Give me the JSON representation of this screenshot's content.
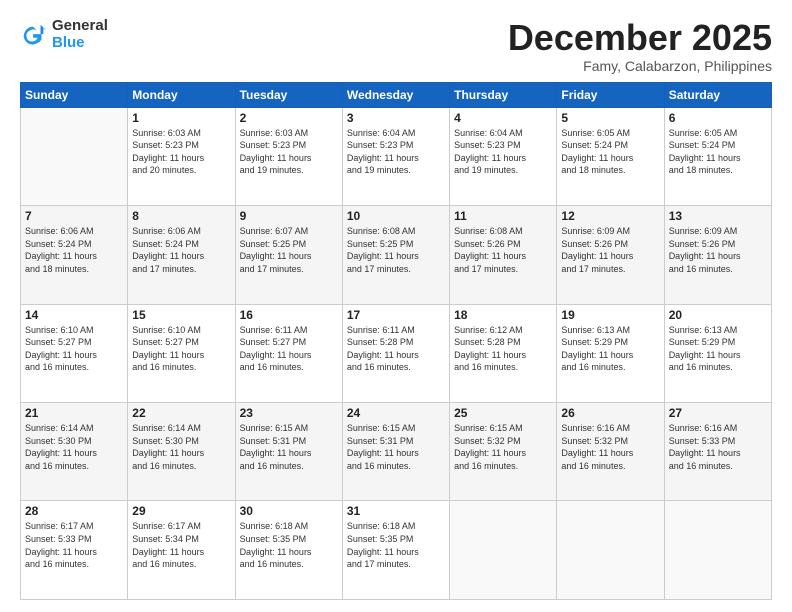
{
  "logo": {
    "general": "General",
    "blue": "Blue"
  },
  "header": {
    "month": "December 2025",
    "location": "Famy, Calabarzon, Philippines"
  },
  "days_of_week": [
    "Sunday",
    "Monday",
    "Tuesday",
    "Wednesday",
    "Thursday",
    "Friday",
    "Saturday"
  ],
  "weeks": [
    [
      {
        "day": "",
        "info": ""
      },
      {
        "day": "1",
        "info": "Sunrise: 6:03 AM\nSunset: 5:23 PM\nDaylight: 11 hours\nand 20 minutes."
      },
      {
        "day": "2",
        "info": "Sunrise: 6:03 AM\nSunset: 5:23 PM\nDaylight: 11 hours\nand 19 minutes."
      },
      {
        "day": "3",
        "info": "Sunrise: 6:04 AM\nSunset: 5:23 PM\nDaylight: 11 hours\nand 19 minutes."
      },
      {
        "day": "4",
        "info": "Sunrise: 6:04 AM\nSunset: 5:23 PM\nDaylight: 11 hours\nand 19 minutes."
      },
      {
        "day": "5",
        "info": "Sunrise: 6:05 AM\nSunset: 5:24 PM\nDaylight: 11 hours\nand 18 minutes."
      },
      {
        "day": "6",
        "info": "Sunrise: 6:05 AM\nSunset: 5:24 PM\nDaylight: 11 hours\nand 18 minutes."
      }
    ],
    [
      {
        "day": "7",
        "info": "Sunrise: 6:06 AM\nSunset: 5:24 PM\nDaylight: 11 hours\nand 18 minutes."
      },
      {
        "day": "8",
        "info": "Sunrise: 6:06 AM\nSunset: 5:24 PM\nDaylight: 11 hours\nand 17 minutes."
      },
      {
        "day": "9",
        "info": "Sunrise: 6:07 AM\nSunset: 5:25 PM\nDaylight: 11 hours\nand 17 minutes."
      },
      {
        "day": "10",
        "info": "Sunrise: 6:08 AM\nSunset: 5:25 PM\nDaylight: 11 hours\nand 17 minutes."
      },
      {
        "day": "11",
        "info": "Sunrise: 6:08 AM\nSunset: 5:26 PM\nDaylight: 11 hours\nand 17 minutes."
      },
      {
        "day": "12",
        "info": "Sunrise: 6:09 AM\nSunset: 5:26 PM\nDaylight: 11 hours\nand 17 minutes."
      },
      {
        "day": "13",
        "info": "Sunrise: 6:09 AM\nSunset: 5:26 PM\nDaylight: 11 hours\nand 16 minutes."
      }
    ],
    [
      {
        "day": "14",
        "info": "Sunrise: 6:10 AM\nSunset: 5:27 PM\nDaylight: 11 hours\nand 16 minutes."
      },
      {
        "day": "15",
        "info": "Sunrise: 6:10 AM\nSunset: 5:27 PM\nDaylight: 11 hours\nand 16 minutes."
      },
      {
        "day": "16",
        "info": "Sunrise: 6:11 AM\nSunset: 5:27 PM\nDaylight: 11 hours\nand 16 minutes."
      },
      {
        "day": "17",
        "info": "Sunrise: 6:11 AM\nSunset: 5:28 PM\nDaylight: 11 hours\nand 16 minutes."
      },
      {
        "day": "18",
        "info": "Sunrise: 6:12 AM\nSunset: 5:28 PM\nDaylight: 11 hours\nand 16 minutes."
      },
      {
        "day": "19",
        "info": "Sunrise: 6:13 AM\nSunset: 5:29 PM\nDaylight: 11 hours\nand 16 minutes."
      },
      {
        "day": "20",
        "info": "Sunrise: 6:13 AM\nSunset: 5:29 PM\nDaylight: 11 hours\nand 16 minutes."
      }
    ],
    [
      {
        "day": "21",
        "info": "Sunrise: 6:14 AM\nSunset: 5:30 PM\nDaylight: 11 hours\nand 16 minutes."
      },
      {
        "day": "22",
        "info": "Sunrise: 6:14 AM\nSunset: 5:30 PM\nDaylight: 11 hours\nand 16 minutes."
      },
      {
        "day": "23",
        "info": "Sunrise: 6:15 AM\nSunset: 5:31 PM\nDaylight: 11 hours\nand 16 minutes."
      },
      {
        "day": "24",
        "info": "Sunrise: 6:15 AM\nSunset: 5:31 PM\nDaylight: 11 hours\nand 16 minutes."
      },
      {
        "day": "25",
        "info": "Sunrise: 6:15 AM\nSunset: 5:32 PM\nDaylight: 11 hours\nand 16 minutes."
      },
      {
        "day": "26",
        "info": "Sunrise: 6:16 AM\nSunset: 5:32 PM\nDaylight: 11 hours\nand 16 minutes."
      },
      {
        "day": "27",
        "info": "Sunrise: 6:16 AM\nSunset: 5:33 PM\nDaylight: 11 hours\nand 16 minutes."
      }
    ],
    [
      {
        "day": "28",
        "info": "Sunrise: 6:17 AM\nSunset: 5:33 PM\nDaylight: 11 hours\nand 16 minutes."
      },
      {
        "day": "29",
        "info": "Sunrise: 6:17 AM\nSunset: 5:34 PM\nDaylight: 11 hours\nand 16 minutes."
      },
      {
        "day": "30",
        "info": "Sunrise: 6:18 AM\nSunset: 5:35 PM\nDaylight: 11 hours\nand 16 minutes."
      },
      {
        "day": "31",
        "info": "Sunrise: 6:18 AM\nSunset: 5:35 PM\nDaylight: 11 hours\nand 17 minutes."
      },
      {
        "day": "",
        "info": ""
      },
      {
        "day": "",
        "info": ""
      },
      {
        "day": "",
        "info": ""
      }
    ]
  ]
}
